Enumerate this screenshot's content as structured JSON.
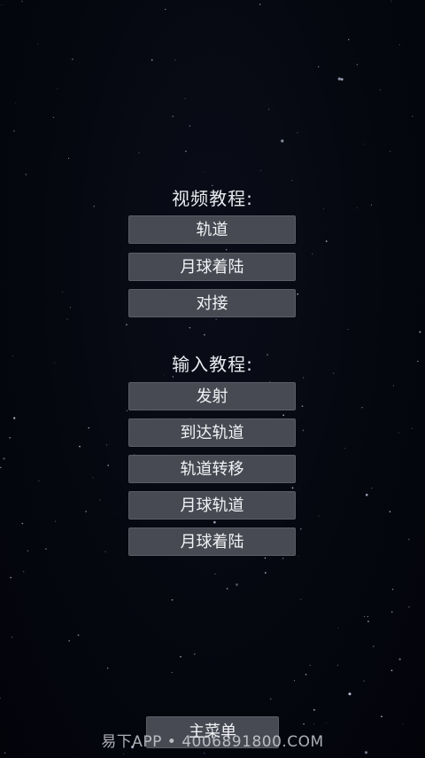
{
  "video_tutorials": {
    "title": "视频教程:",
    "buttons": [
      "轨道",
      "月球着陆",
      "对接"
    ]
  },
  "input_tutorials": {
    "title": "输入教程:",
    "buttons": [
      "发射",
      "到达轨道",
      "轨道转移",
      "月球轨道",
      "月球着陆"
    ]
  },
  "footer": {
    "main_menu_label": "主菜单",
    "watermark_text": "易下APP • 4006891800.COM"
  },
  "colors": {
    "background": "#05070f",
    "button_bg": "#474a52",
    "text": "#f2f3f6"
  }
}
